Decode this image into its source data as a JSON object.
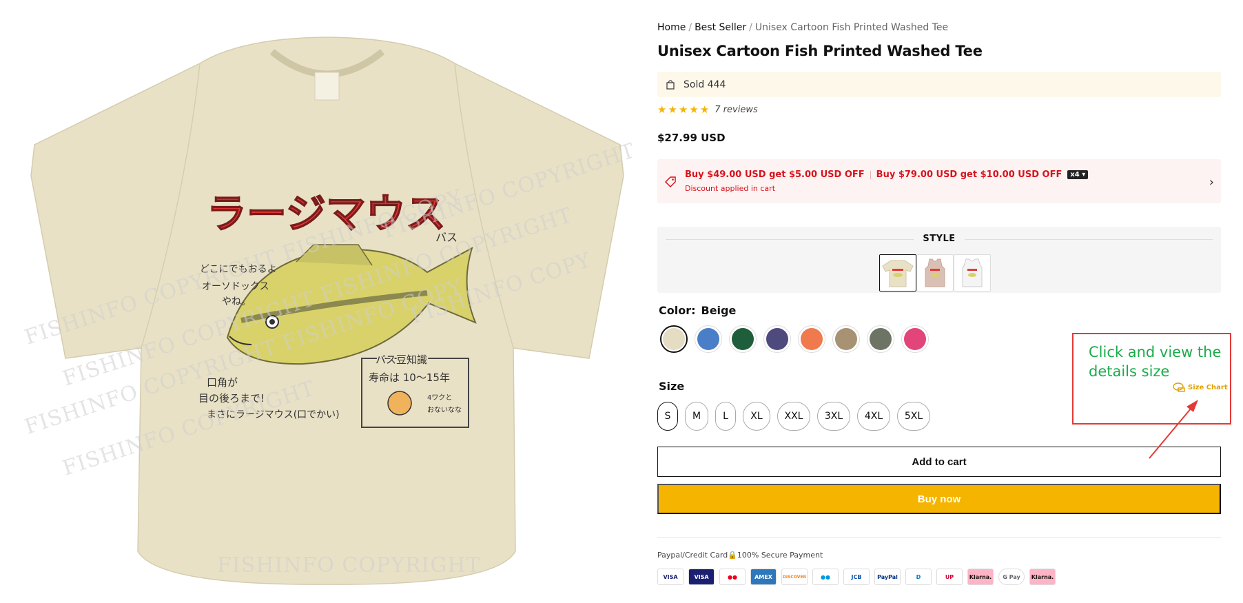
{
  "breadcrumb": {
    "home": "Home",
    "sep1": "/",
    "category": "Best Seller",
    "sep2": "/",
    "current": "Unisex Cartoon Fish Printed Washed Tee"
  },
  "product": {
    "title": "Unisex Cartoon Fish Printed Washed Tee",
    "sold": "Sold 444",
    "rating": 5,
    "stars": [
      "★",
      "★",
      "★",
      "★",
      "★"
    ],
    "reviews": "7 reviews",
    "price": "$27.99 USD"
  },
  "discount": {
    "offer1": "Buy $49.00 USD get $5.00 USD OFF",
    "offer2": "Buy $79.00 USD get $10.00 USD OFF",
    "multiplier": "x4 ▾",
    "note": "Discount applied in cart",
    "chevron": "›"
  },
  "style": {
    "label": "STYLE",
    "thumbs": [
      "tee",
      "tank-top",
      "sleeveless"
    ],
    "selected_index": 0
  },
  "color": {
    "label": "Color:",
    "selected": "Beige",
    "swatches": [
      {
        "name": "Beige",
        "hex": "#e4dcc3"
      },
      {
        "name": "Blue",
        "hex": "#4a7ec6"
      },
      {
        "name": "Green",
        "hex": "#1f5e3a"
      },
      {
        "name": "Purple",
        "hex": "#4f4a7d"
      },
      {
        "name": "Orange",
        "hex": "#f07a4d"
      },
      {
        "name": "Khaki",
        "hex": "#a79273"
      },
      {
        "name": "Grey",
        "hex": "#6d7465"
      },
      {
        "name": "Pink",
        "hex": "#e2457a"
      }
    ]
  },
  "size": {
    "label": "Size",
    "options": [
      "S",
      "M",
      "L",
      "XL",
      "XXL",
      "3XL",
      "4XL",
      "5XL"
    ],
    "selected": "S",
    "size_chart": "Size Chart"
  },
  "annotation": {
    "text": "Click and view the details size"
  },
  "actions": {
    "add_to_cart": "Add to cart",
    "buy_now": "Buy now"
  },
  "payment": {
    "secure_text": "Paypal/Credit Card🔒100% Secure Payment",
    "methods": [
      {
        "label": "VISA",
        "color": "#1a1f71"
      },
      {
        "label": "VISA",
        "color": "#1a1f71"
      },
      {
        "label": "●●",
        "color": "#eb001b"
      },
      {
        "label": "AMEX",
        "color": "#2e77bb"
      },
      {
        "label": "DISCOVER",
        "color": "#f58220"
      },
      {
        "label": "●●",
        "color": "#0099df"
      },
      {
        "label": "JCB",
        "color": "#0b4ea2"
      },
      {
        "label": "PayPal",
        "color": "#003087"
      },
      {
        "label": "D",
        "color": "#0079be"
      },
      {
        "label": "UP",
        "color": "#d50032"
      },
      {
        "label": "Klarna.",
        "color": "#17120f"
      },
      {
        "label": "G Pay",
        "color": "#5f6368"
      },
      {
        "label": "Klarna.",
        "color": "#17120f"
      }
    ]
  },
  "image": {
    "shirt_color": "#e8e1c6",
    "print_title": "ラージマウス",
    "print_sub": "バス",
    "note_left": [
      "どこにでもおるよ",
      "オーソドックス",
      "やね。"
    ],
    "note_mouth": [
      "口角が",
      "目の後ろまで!",
      "まさにラージマウス(口でかい)"
    ],
    "box_title": "バス豆知識",
    "box_text": "寿命は 10〜15年",
    "box_small": [
      "4ワクと",
      "おないなな"
    ],
    "watermark": "FISHINFO COPYRIGHT"
  }
}
